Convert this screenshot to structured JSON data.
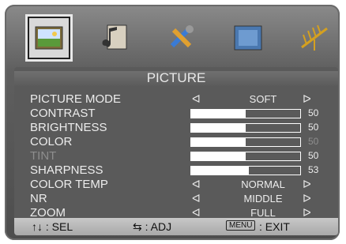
{
  "tabs": [
    {
      "icon": "picture-icon",
      "selected": true
    },
    {
      "icon": "audio-icon",
      "selected": false
    },
    {
      "icon": "setup-tools-icon",
      "selected": false
    },
    {
      "icon": "screen-icon",
      "selected": false
    },
    {
      "icon": "channel-antenna-icon",
      "selected": false
    }
  ],
  "title": "PICTURE",
  "rows": {
    "picture_mode": {
      "label": "PICTURE MODE",
      "value": "SOFT"
    },
    "contrast": {
      "label": "CONTRAST",
      "value": "50",
      "level": 50
    },
    "brightness": {
      "label": "BRIGHTNESS",
      "value": "50",
      "level": 50
    },
    "color": {
      "label": "COLOR",
      "value": "50",
      "level": 50
    },
    "tint": {
      "label": "TINT",
      "value": "50",
      "level": 50
    },
    "sharpness": {
      "label": "SHARPNESS",
      "value": "53",
      "level": 53
    },
    "color_temp": {
      "label": "COLOR TEMP",
      "value": "NORMAL"
    },
    "nr": {
      "label": "NR",
      "value": "MIDDLE"
    },
    "zoom": {
      "label": "ZOOM",
      "value": "FULL"
    }
  },
  "footer": {
    "sel": "↑↓ : SEL",
    "adj": "⇆ : ADJ",
    "menu_key": "MENU",
    "exit": ": EXIT"
  }
}
